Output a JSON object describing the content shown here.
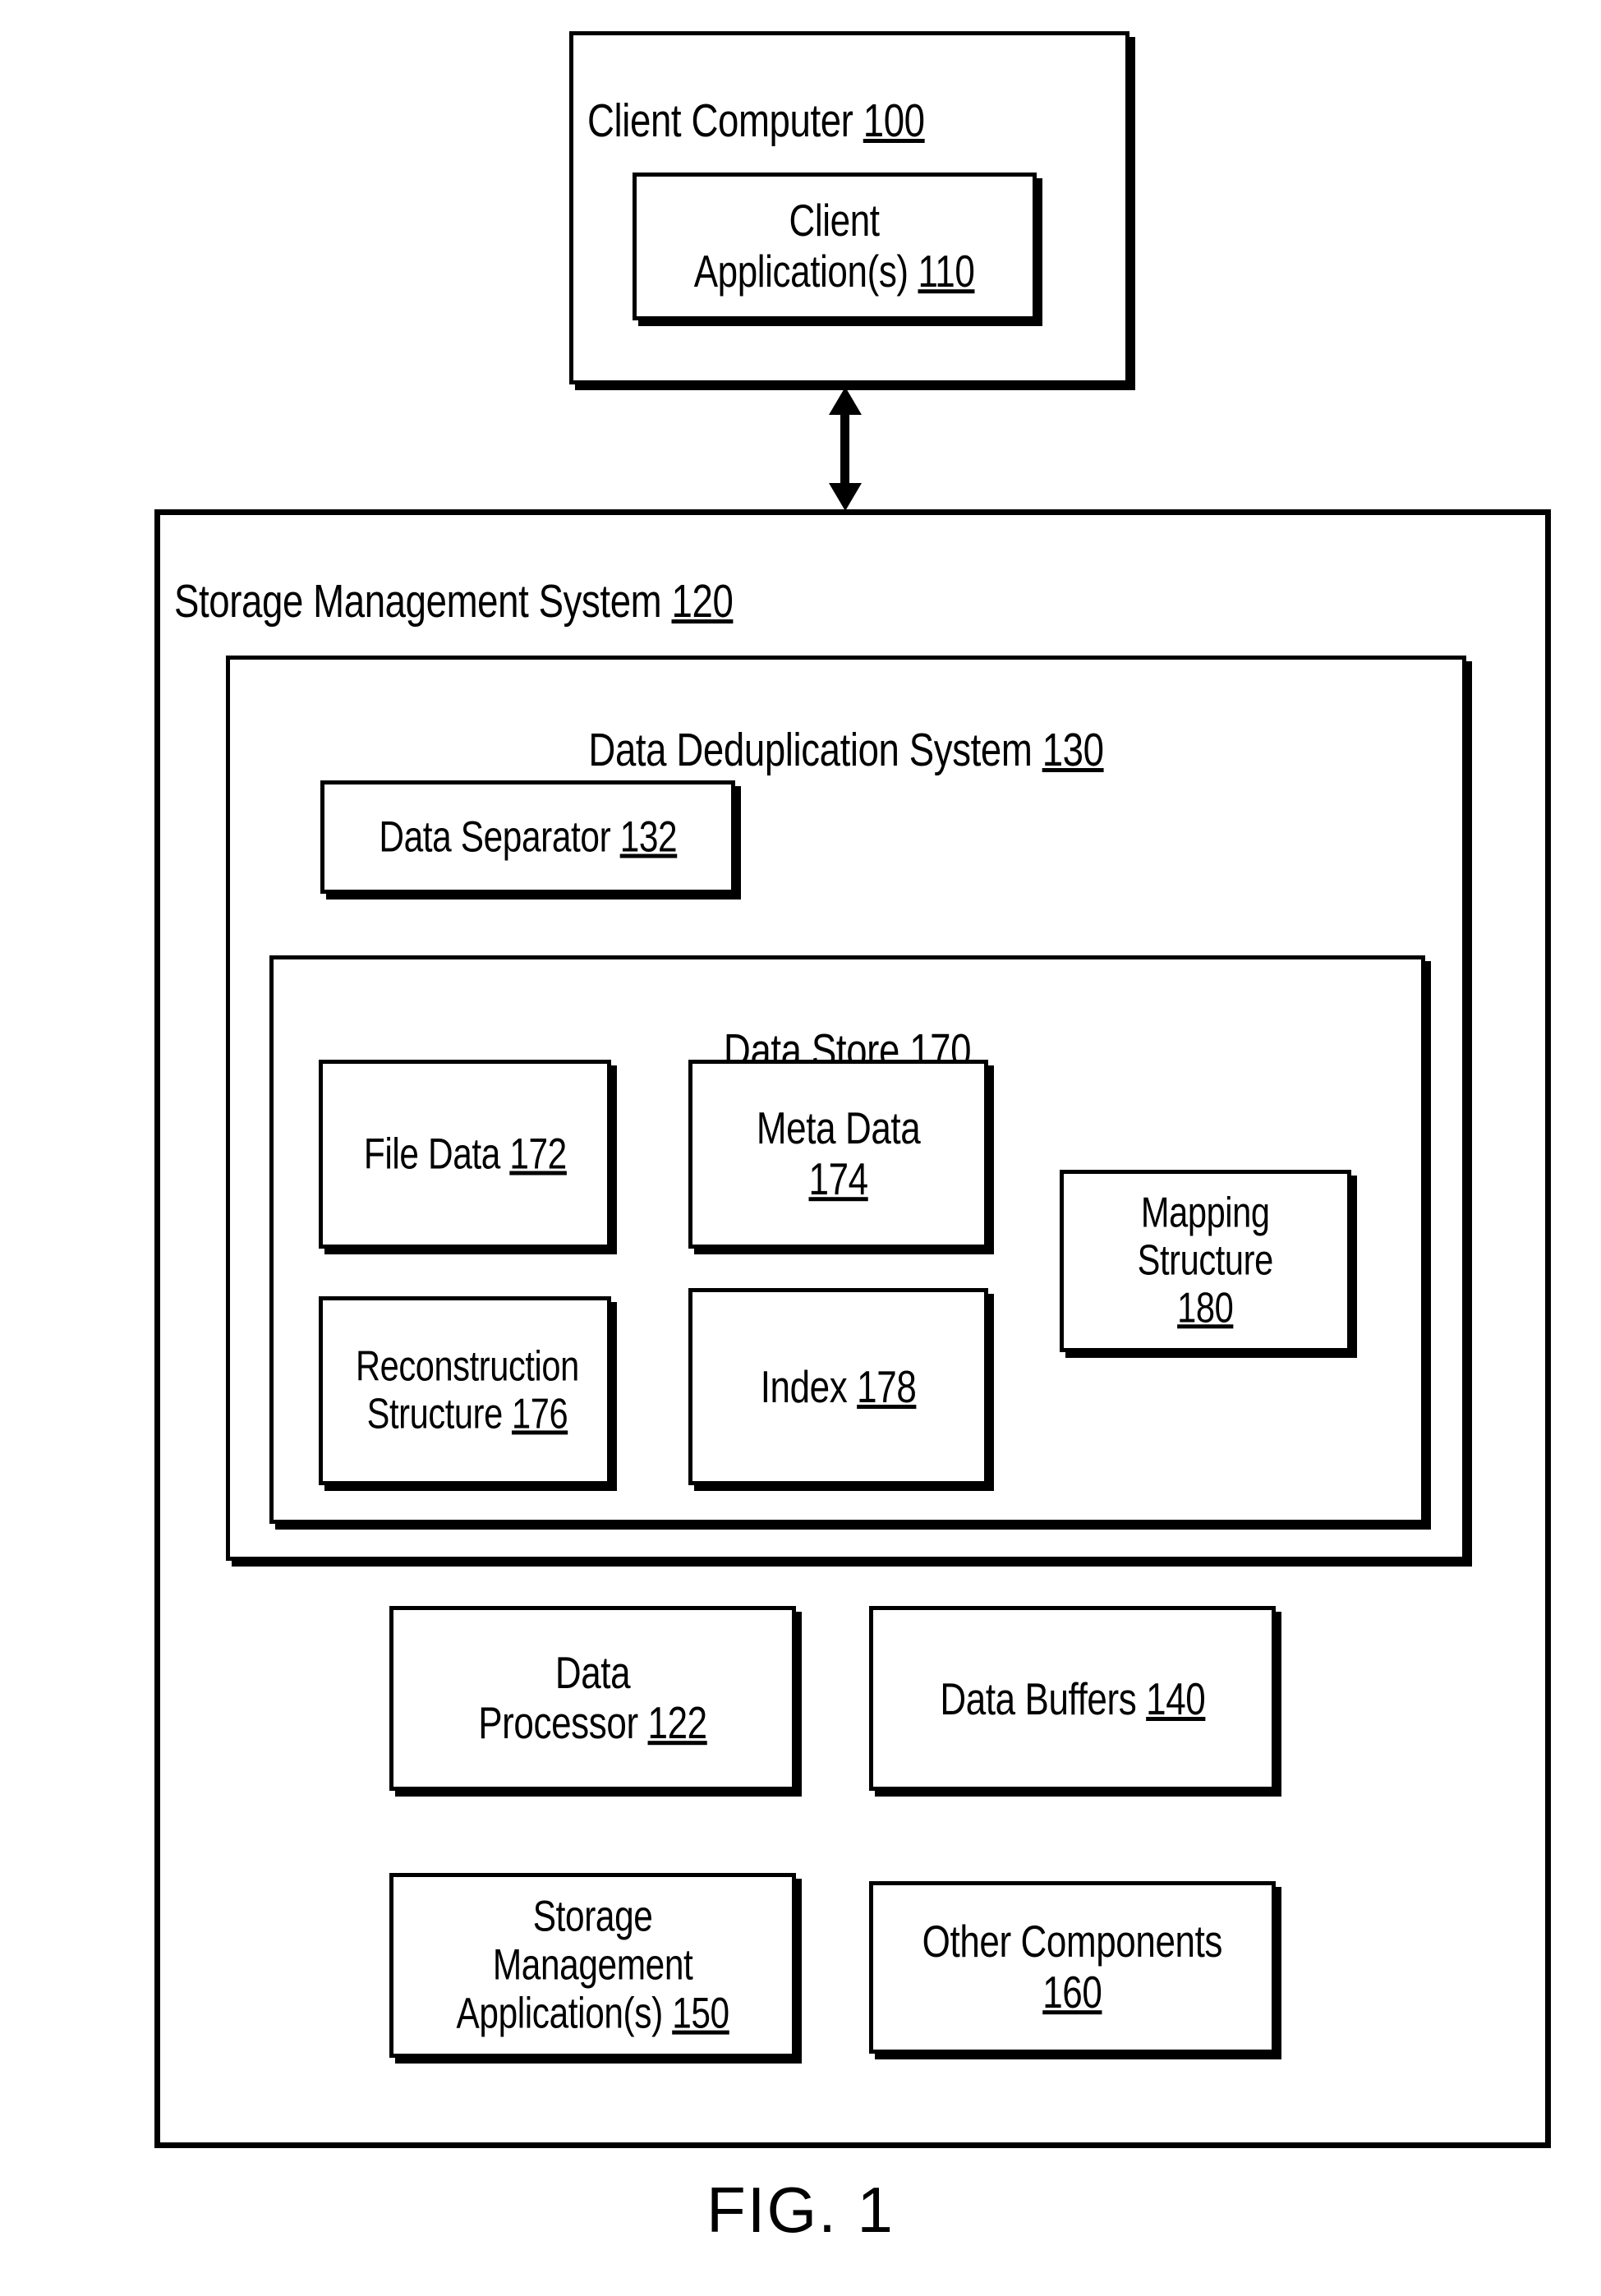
{
  "figure": {
    "caption": "FIG. 1",
    "ink_color": "#000000",
    "background_color": "#ffffff"
  },
  "client_computer": {
    "title": "Client Computer",
    "ref": "100",
    "application_box": {
      "title": "Client\nApplication(s)",
      "ref": "110"
    }
  },
  "connector": {
    "type": "double-headed-arrow",
    "orientation": "vertical",
    "from": "Client Computer 100",
    "to": "Storage Management System 120"
  },
  "storage_management_system": {
    "title": "Storage Management System",
    "ref": "120",
    "deduplication_system": {
      "title": "Data Deduplication System",
      "ref": "130",
      "data_separator": {
        "title": "Data Separator",
        "ref": "132"
      },
      "data_store": {
        "title": "Data Store",
        "ref": "170",
        "components": [
          {
            "title": "File Data",
            "ref": "172"
          },
          {
            "title": "Meta Data",
            "ref": "174"
          },
          {
            "title": "Mapping\nStructure",
            "ref": "180"
          },
          {
            "title": "Reconstruction\nStructure",
            "ref": "176"
          },
          {
            "title": "Index",
            "ref": "178"
          }
        ]
      }
    },
    "components": [
      {
        "title": "Data Processor",
        "ref": "122"
      },
      {
        "title": "Data Buffers",
        "ref": "140"
      },
      {
        "title": "Storage\nManagement\nApplication(s)",
        "ref": "150"
      },
      {
        "title": "Other Components",
        "ref": "160"
      }
    ]
  }
}
